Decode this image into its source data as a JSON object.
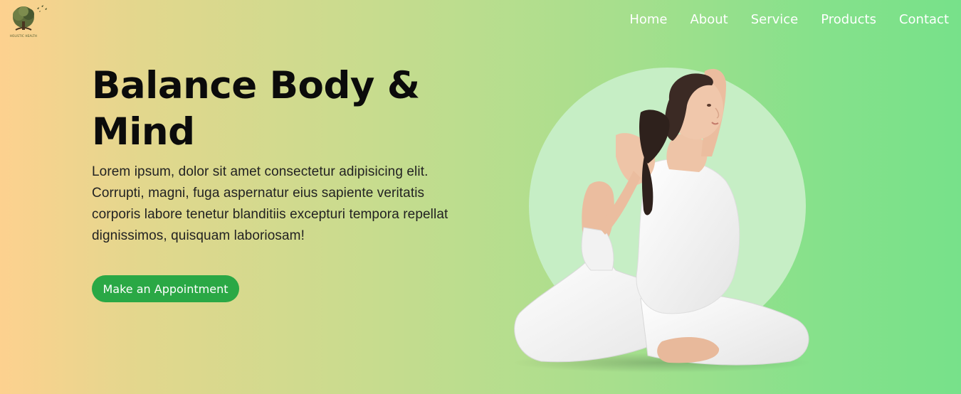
{
  "logo": {
    "text": "HOLISTIC HEALTH",
    "icon": "tree-logo-icon"
  },
  "nav": {
    "items": [
      {
        "label": "Home"
      },
      {
        "label": "About"
      },
      {
        "label": "Service"
      },
      {
        "label": "Products"
      },
      {
        "label": "Contact"
      }
    ]
  },
  "hero": {
    "title": "Balance Body & Mind",
    "body": "Lorem ipsum, dolor sit amet consectetur adipisicing elit. Corrupti, magni, fuga aspernatur eius sapiente veritatis corporis labore tenetur blanditiis excepturi tempora repellat dignissimos, quisquam laboriosam!",
    "cta_label": "Make an Appointment",
    "image": "yoga-woman-illustration"
  },
  "colors": {
    "gradient_start": "#fdd18f",
    "gradient_end": "#77e18a",
    "cta": "#2aa845",
    "circle": "#c6eec5",
    "nav_text": "#ffffff"
  }
}
